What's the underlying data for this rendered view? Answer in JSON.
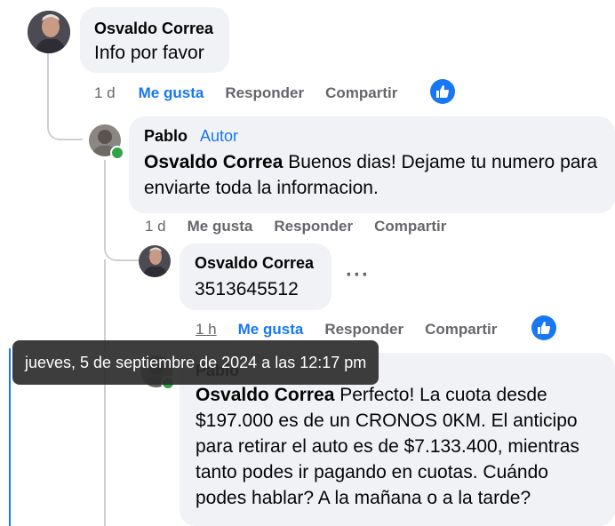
{
  "comments": [
    {
      "author": "Osvaldo Correa",
      "text": "Info por favor",
      "time": "1 d",
      "like": "Me gusta",
      "reply": "Responder",
      "share": "Compartir"
    },
    {
      "author": "Pablo",
      "badge": "Autor",
      "mention": "Osvaldo Correa",
      "text": " Buenos dias! Dejame tu numero para enviarte toda la informacion.",
      "time": "1 d",
      "like": "Me gusta",
      "reply": "Responder",
      "share": "Compartir"
    },
    {
      "author": "Osvaldo Correa",
      "text": "3513645512",
      "time": "1 h",
      "like": "Me gusta",
      "reply": "Responder",
      "share": "Compartir"
    },
    {
      "author": "Pablo",
      "mention": "Osvaldo Correa",
      "text": " Perfecto! La cuota desde $197.000 es de un CRONOS 0KM. El anticipo para retirar el auto es de $7.133.400, mientras tanto podes ir pagando en cuotas. Cuándo podes hablar? A la mañana o a la tarde?"
    }
  ],
  "tooltip": "jueves, 5 de septiembre de 2024 a las 12:17 pm",
  "colors": {
    "accent": "#1877f2",
    "bubble": "#f0f2f5",
    "online": "#31a24c"
  },
  "icons": {
    "like_reaction": "thumbs-up-icon",
    "more": "more-options-icon"
  }
}
